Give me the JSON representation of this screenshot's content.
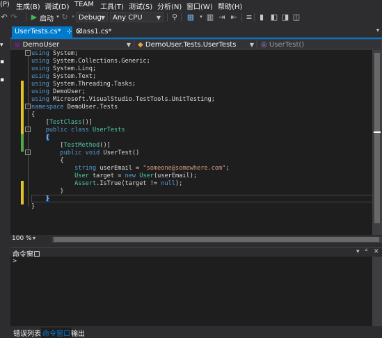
{
  "menu": {
    "items": [
      "(P)",
      "生成(B)",
      "调试(D)",
      "TEAM",
      "工具(T)",
      "测试(S)",
      "分析(N)",
      "窗口(W)",
      "帮助(H)"
    ]
  },
  "toolbar": {
    "start_label": "启动",
    "config_value": "Debug",
    "platform_value": "Any CPU",
    "icons": [
      "back-icon",
      "forward-icon",
      "play-icon",
      "refresh-icon",
      "breakpoint-icon",
      "find-icon",
      "indent-icon",
      "comment-icon",
      "bookmark-icon"
    ]
  },
  "tabs": [
    {
      "label": "UserTests.cs*",
      "pin": "⊹",
      "close": "×"
    },
    {
      "label": "Class1.cs*"
    }
  ],
  "navbar": {
    "project": "DemoUser",
    "class": "DemoUser.Tests.UserTests",
    "member": "UserTest()"
  },
  "code": [
    "using System;",
    "using System.Collections.Generic;",
    "using System.Linq;",
    "using System.Text;",
    "using System.Threading.Tasks;",
    "using DemoUser;",
    "using Microsoft.VisualStudio.TestTools.UnitTesting;",
    "namespace DemoUser.Tests",
    "{",
    "    [TestClass()]",
    "    public class UserTests",
    "    {",
    "        [TestMethod()]",
    "        public void UserTest()",
    "        {",
    "            string userEmail = \"someone@somewhere.com\";",
    "            User target = new User(userEmail);",
    "            Assert.IsTrue(target != null);",
    "        }",
    "    }",
    "}"
  ],
  "zoom": "100 %",
  "command_window": {
    "title": "命令窗口",
    "prompt": ">"
  },
  "bottom_tabs": [
    "错误列表",
    "命令窗口",
    "输出"
  ],
  "colors": {
    "accent": "#007acc",
    "keyword": "#569cd6",
    "type": "#4ec9b0",
    "string": "#d69d85",
    "change_marker": "#e3c22a"
  }
}
